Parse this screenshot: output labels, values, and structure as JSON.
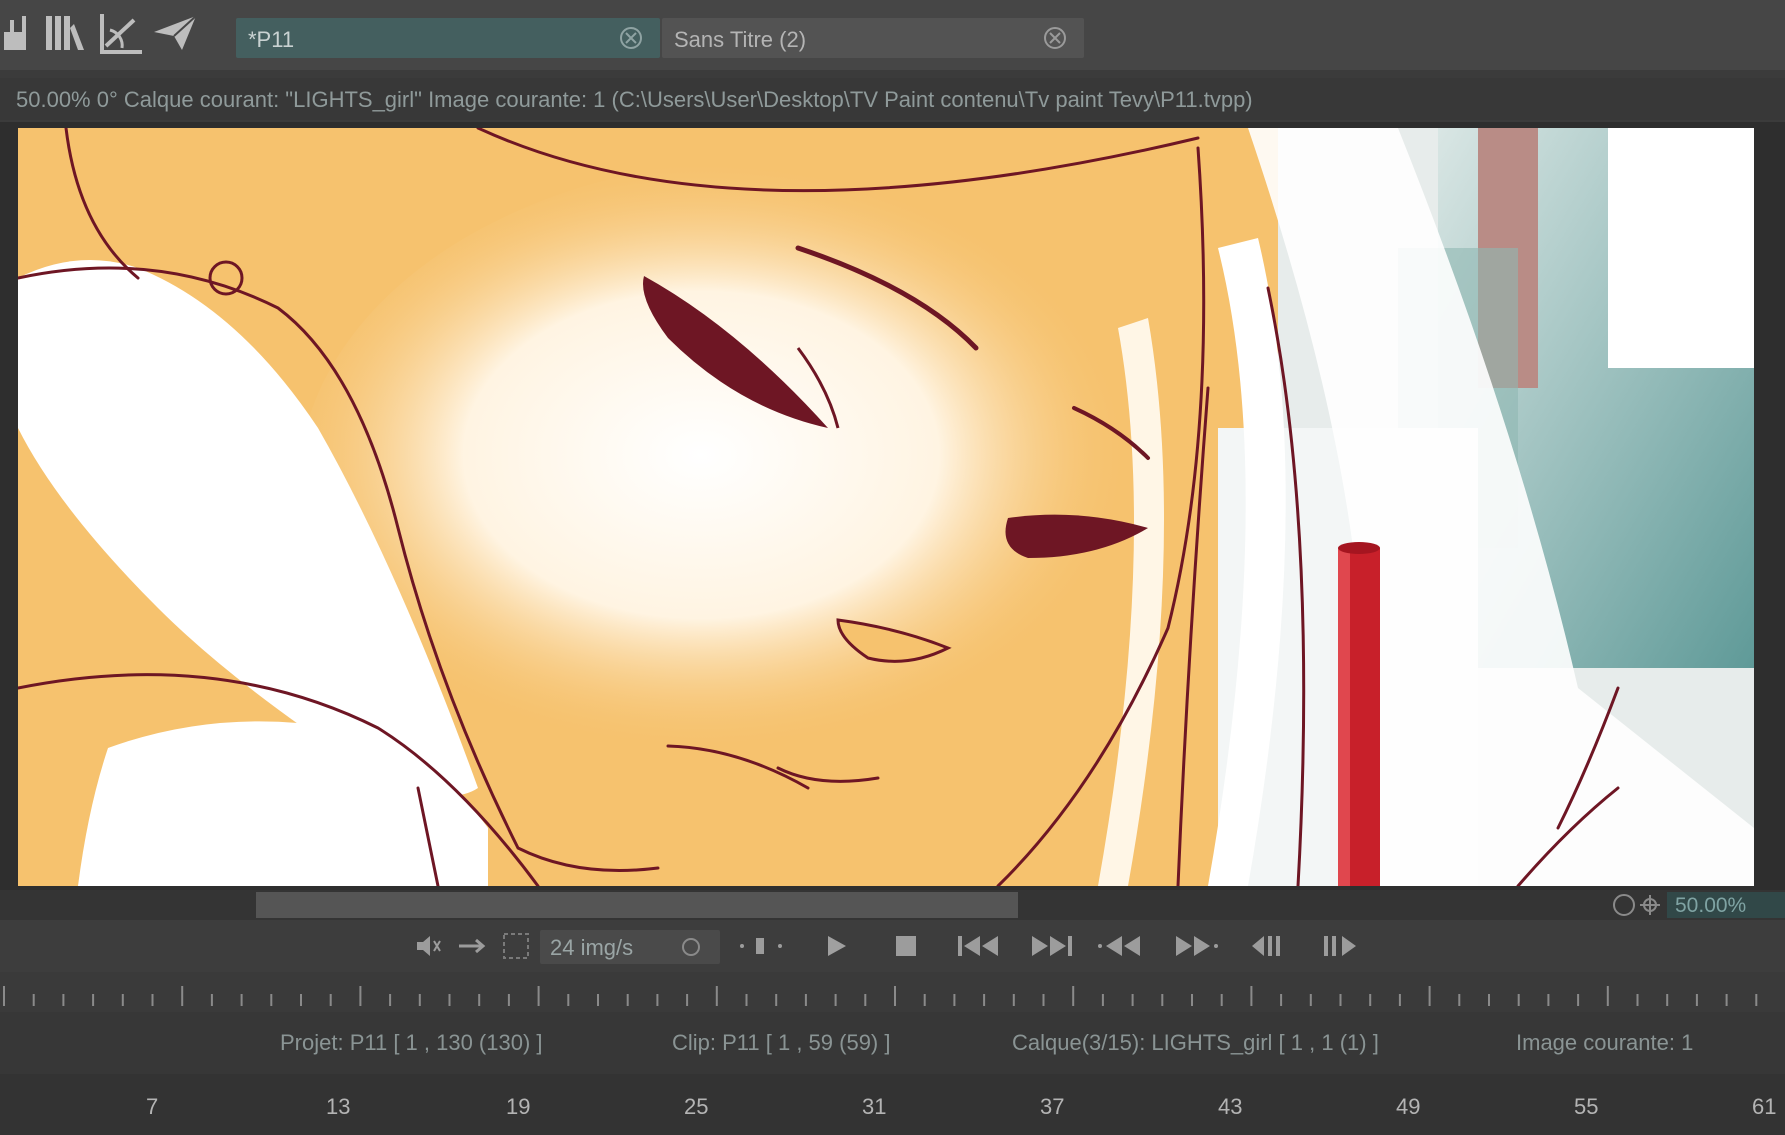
{
  "toolbar": {
    "icons": [
      "brush-tool-icon",
      "panels-icon",
      "ruler-tool-icon",
      "paper-plane-icon"
    ],
    "tabs": [
      {
        "label": "*P11",
        "active": true
      },
      {
        "label": "Sans Titre (2)",
        "active": false
      }
    ]
  },
  "status": {
    "text": "50.00%  0°  Calque courant: \"LIGHTS_girl\"  Image courante: 1 (C:\\Users\\User\\Desktop\\TV Paint contenu\\Tv paint Tevy\\P11.tvpp)"
  },
  "view": {
    "zoom": "50.00%"
  },
  "transport": {
    "fps": "24 img/s",
    "buttons": [
      "play",
      "stop",
      "first-frame",
      "last-frame",
      "previous-frame",
      "next-frame",
      "previous-key",
      "next-key"
    ]
  },
  "info": {
    "project": "Projet: P11 [ 1 , 130  (130) ]",
    "clip": "Clip: P11 [ 1 , 59  (59) ]",
    "layer": "Calque(3/15): LIGHTS_girl [ 1 , 1  (1) ]",
    "current_frame": "Image courante: 1"
  },
  "frame_numbers": [
    "7",
    "13",
    "19",
    "25",
    "31",
    "37",
    "43",
    "49",
    "55",
    "61"
  ],
  "colors": {
    "accent": "#314848",
    "skin": "#f6c26e",
    "lineart": "#6e1624"
  }
}
